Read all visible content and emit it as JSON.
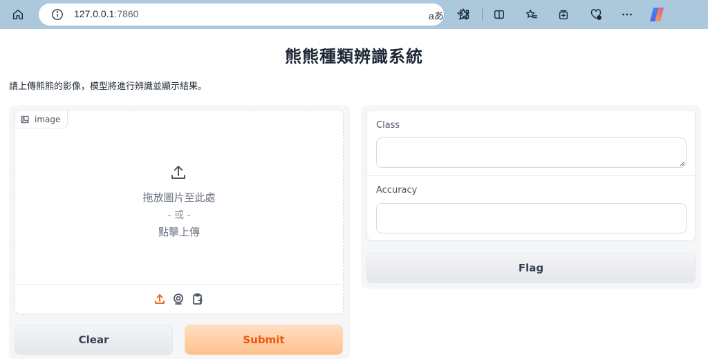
{
  "browser": {
    "url_host": "127.0.0.1",
    "url_port": ":7860",
    "read_aloud": "aあ"
  },
  "app": {
    "title": "熊熊種類辨識系統",
    "description": "請上傳熊熊的影像，模型將進行辨識並顯示結果。",
    "input": {
      "label": "image",
      "drop_text": "拖放圖片至此處",
      "or_text": "- 或 -",
      "click_text": "點擊上傳",
      "sources": [
        "upload-icon",
        "webcam-icon",
        "clipboard-icon"
      ]
    },
    "clear_label": "Clear",
    "submit_label": "Submit",
    "outputs": {
      "class_label": "Class",
      "class_value": "",
      "accuracy_label": "Accuracy",
      "accuracy_value": ""
    },
    "flag_label": "Flag"
  },
  "colors": {
    "accent": "#ea580c",
    "chrome": "#abc8dd"
  }
}
